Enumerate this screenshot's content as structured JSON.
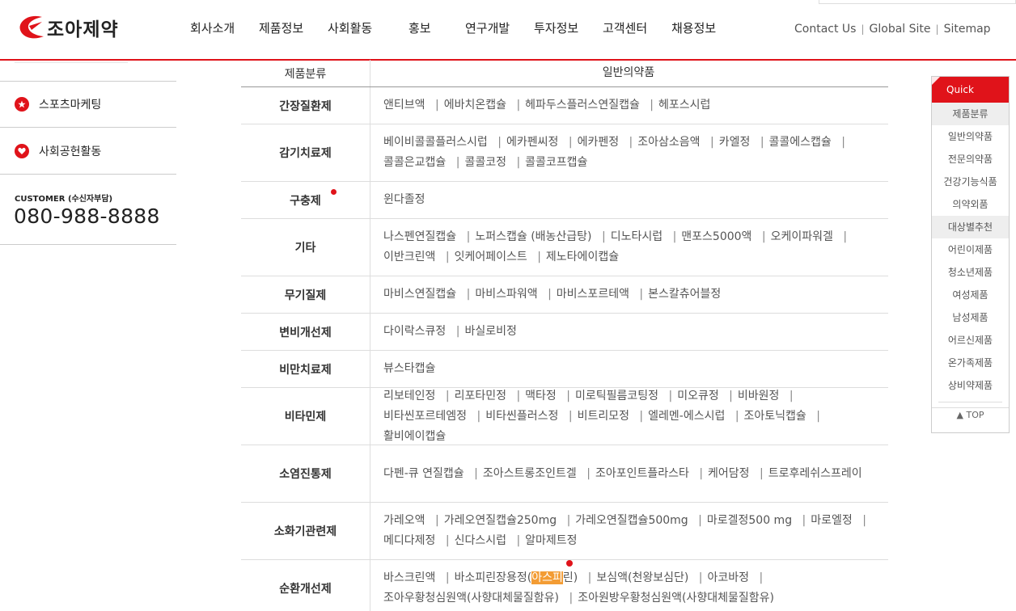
{
  "brand": {
    "name": "조아제약",
    "color": "#e0131a"
  },
  "gnb": [
    "회사소개",
    "제품정보",
    "사회활동",
    "홍보",
    "연구개발",
    "투자정보",
    "고객센터",
    "채용정보"
  ],
  "util": [
    "Contact Us",
    "Global Site",
    "Sitemap"
  ],
  "sidebar": {
    "items": [
      {
        "label": "스포츠마케팅",
        "icon": "star-icon"
      },
      {
        "label": "사회공헌활동",
        "icon": "heart-icon"
      }
    ],
    "customer": {
      "label": "CUSTOMER (수신자부담)",
      "phone": "080-988-8888"
    }
  },
  "table": {
    "header": {
      "col1": "제품분류",
      "col2": "일반의약품"
    },
    "rows": [
      {
        "cat": "간장질환제",
        "items": [
          "앤티브액",
          "에바치온캡슐",
          "헤파두스플러스연질캡슐",
          "헤포스시럽"
        ]
      },
      {
        "cat": "감기치료제",
        "items": [
          "베이비콜콜플러스시럽",
          "에카펜씨정",
          "에카펜정",
          "조아삼소음액",
          "카엘정",
          "콜콜에스캡슐",
          "콜콜은교캡슐",
          "콜콜코정",
          "콜콜코프캡슐"
        ]
      },
      {
        "cat": "구충제",
        "items": [
          "윈다졸정"
        ]
      },
      {
        "cat": "기타",
        "items": [
          "나스펜연질캡슐",
          "노퍼스캡슐 (배농산급탕)",
          "디노타시럽",
          "맨포스5000액",
          "오케이파워겔",
          "이반크린액",
          "잇케어페이스트",
          "제노타에이캡슐"
        ]
      },
      {
        "cat": "무기질제",
        "items": [
          "마비스연질캡슐",
          "마비스파워액",
          "마비스포르테액",
          "본스칼츄어블정"
        ]
      },
      {
        "cat": "변비개선제",
        "items": [
          "다이락스큐정",
          "바실로비정"
        ]
      },
      {
        "cat": "비만치료제",
        "items": [
          "뷰스타캡슐"
        ]
      },
      {
        "cat": "비타민제",
        "items": [
          "리보테인정",
          "리포타민정",
          "맥타정",
          "미로틱필름코팅정",
          "미오큐정",
          "비바원정",
          "비타씬포르테엠정",
          "비타씬플러스정",
          "비트리모정",
          "엘레멘-에스시럽",
          "조아토닉캡슐",
          "활비에이캡슐"
        ]
      },
      {
        "cat": "소염진통제",
        "items": [
          "다펜-큐 연질캡슐",
          "조아스트롱조인트겔",
          "조아포인트플라스타",
          "케어담정",
          "트로후레쉬스프레이"
        ]
      },
      {
        "cat": "소화기관련제",
        "items": [
          "가레오액",
          "가레오연질캡슐250mg",
          "가레오연질캡슐500mg",
          "마로겔정500 mg",
          "마로엘정",
          "메디다제정",
          "신다스시럽",
          "알마제트정"
        ]
      },
      {
        "cat": "순환개선제",
        "items": [
          "바스크린액",
          "바소피린장용정(아스피린)",
          "보심액(천왕보심단)",
          "아코바정",
          "조아우황청심원액(사향대체물질함유)",
          "조아원방우황청심원액(사향대체물질함유)"
        ]
      }
    ],
    "highlight": "아스피"
  },
  "quick": {
    "title": "Quick",
    "sections": [
      {
        "title": "제품분류",
        "items": [
          "일반의약품",
          "전문의약품",
          "건강기능식품",
          "의약외품"
        ]
      },
      {
        "title": "대상별추천",
        "items": [
          "어린이제품",
          "청소년제품",
          "여성제품",
          "남성제품",
          "어르신제품",
          "온가족제품",
          "상비약제품"
        ]
      }
    ],
    "top": "TOP"
  }
}
